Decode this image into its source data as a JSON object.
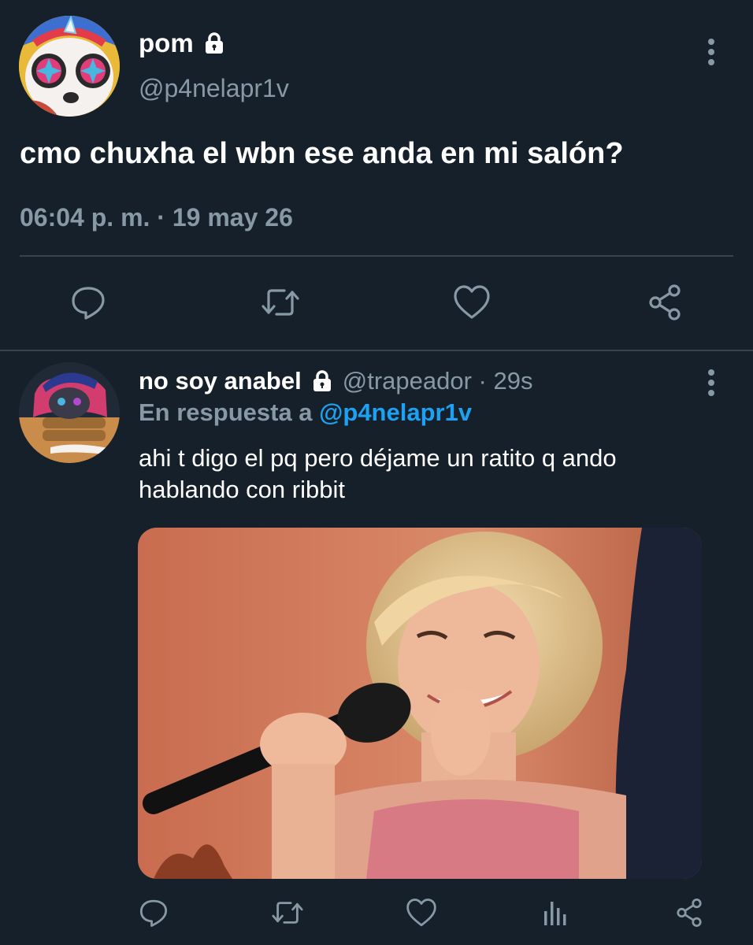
{
  "main_tweet": {
    "display_name": "pom",
    "handle": "@p4nelapr1v",
    "text": "cmo chuxha el wbn ese anda en mi salón?",
    "time": "06:04 p. m.",
    "separator": " · ",
    "date": "19 may 26",
    "icons": [
      "lock-icon",
      "more-icon",
      "reply-icon",
      "retweet-icon",
      "like-icon",
      "share-icon"
    ]
  },
  "reply_tweet": {
    "display_name": "no soy anabel",
    "handle": "@trapeador",
    "separator": " · ",
    "age": "29s",
    "reply_prefix": "En respuesta a ",
    "reply_to": "@p4nelapr1v",
    "text": "ahi t digo el pq pero déjame un ratito q ando hablando con ribbit",
    "icons": [
      "lock-icon",
      "more-icon",
      "reply-icon",
      "retweet-icon",
      "like-icon",
      "analytics-icon",
      "share-icon"
    ]
  },
  "colors": {
    "background": "#15202b",
    "text_primary": "#ffffff",
    "text_secondary": "#8899a6",
    "accent": "#1da1f2",
    "divider": "#38444d"
  }
}
